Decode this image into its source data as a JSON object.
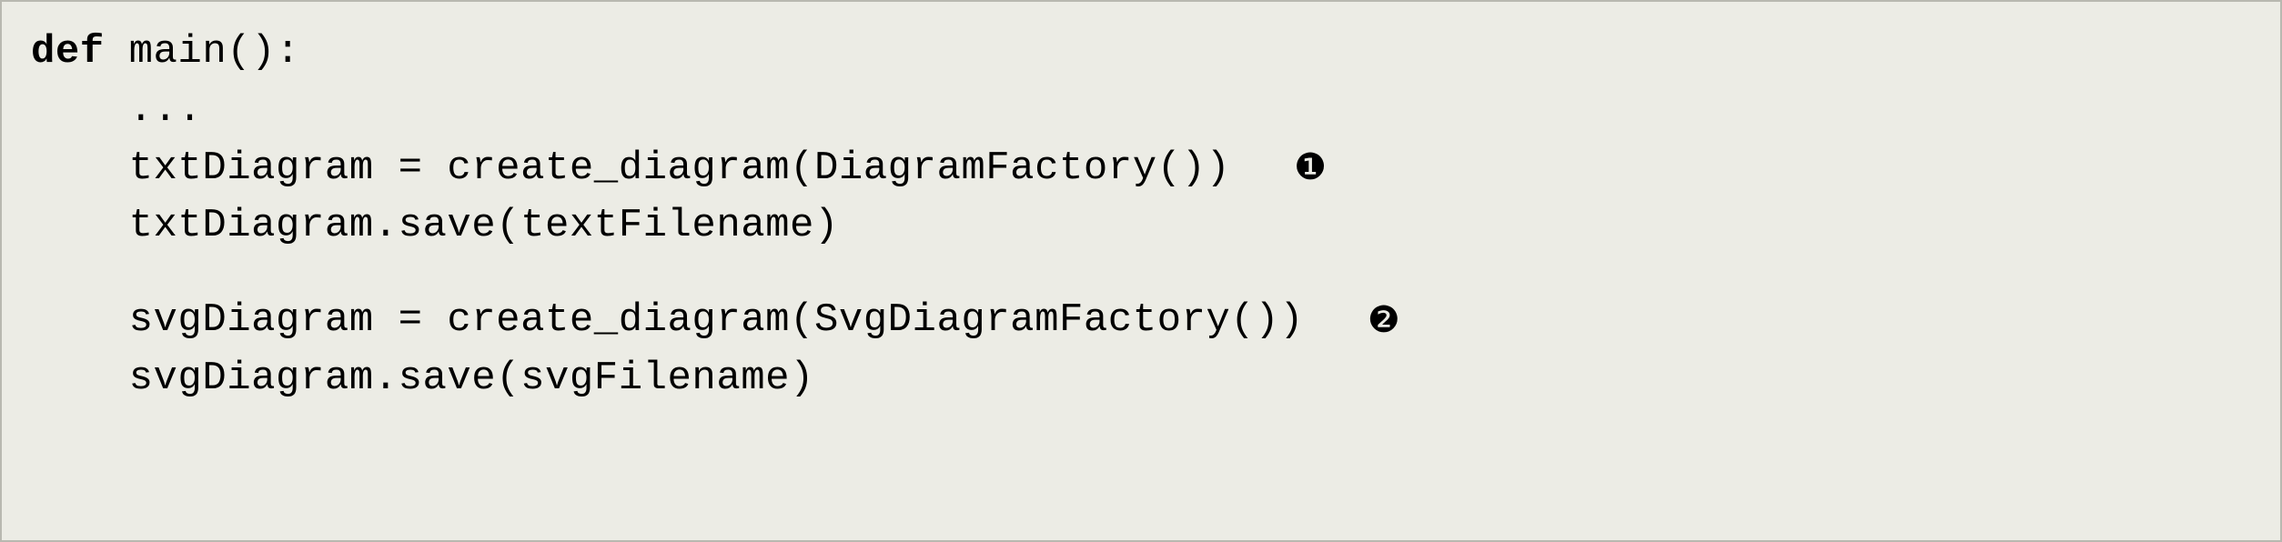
{
  "code": {
    "line1_keyword": "def",
    "line1_rest": " main():",
    "line2": "    ...",
    "line3": "    txtDiagram = create_diagram(DiagramFactory())",
    "line3_marker": "❶",
    "line4": "    txtDiagram.save(textFilename)",
    "line5": "    svgDiagram = create_diagram(SvgDiagramFactory())",
    "line5_marker": "❷",
    "line6": "    svgDiagram.save(svgFilename)"
  }
}
